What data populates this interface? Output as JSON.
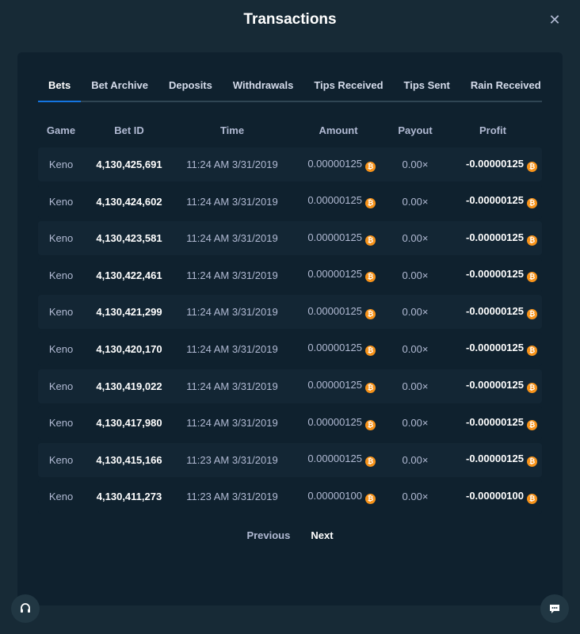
{
  "modal": {
    "title": "Transactions",
    "close_icon": "close-icon"
  },
  "tabs": [
    {
      "label": "Bets",
      "active": true
    },
    {
      "label": "Bet Archive"
    },
    {
      "label": "Deposits"
    },
    {
      "label": "Withdrawals"
    },
    {
      "label": "Tips Received"
    },
    {
      "label": "Tips Sent"
    },
    {
      "label": "Rain Received"
    }
  ],
  "table": {
    "headers": [
      "Game",
      "Bet ID",
      "Time",
      "Amount",
      "Payout",
      "Profit"
    ],
    "rows": [
      {
        "game": "Keno",
        "bet_id": "4,130,425,691",
        "time": "11:24 AM 3/31/2019",
        "amount": "0.00000125",
        "payout": "0.00×",
        "profit": "-0.00000125"
      },
      {
        "game": "Keno",
        "bet_id": "4,130,424,602",
        "time": "11:24 AM 3/31/2019",
        "amount": "0.00000125",
        "payout": "0.00×",
        "profit": "-0.00000125"
      },
      {
        "game": "Keno",
        "bet_id": "4,130,423,581",
        "time": "11:24 AM 3/31/2019",
        "amount": "0.00000125",
        "payout": "0.00×",
        "profit": "-0.00000125"
      },
      {
        "game": "Keno",
        "bet_id": "4,130,422,461",
        "time": "11:24 AM 3/31/2019",
        "amount": "0.00000125",
        "payout": "0.00×",
        "profit": "-0.00000125"
      },
      {
        "game": "Keno",
        "bet_id": "4,130,421,299",
        "time": "11:24 AM 3/31/2019",
        "amount": "0.00000125",
        "payout": "0.00×",
        "profit": "-0.00000125"
      },
      {
        "game": "Keno",
        "bet_id": "4,130,420,170",
        "time": "11:24 AM 3/31/2019",
        "amount": "0.00000125",
        "payout": "0.00×",
        "profit": "-0.00000125"
      },
      {
        "game": "Keno",
        "bet_id": "4,130,419,022",
        "time": "11:24 AM 3/31/2019",
        "amount": "0.00000125",
        "payout": "0.00×",
        "profit": "-0.00000125"
      },
      {
        "game": "Keno",
        "bet_id": "4,130,417,980",
        "time": "11:24 AM 3/31/2019",
        "amount": "0.00000125",
        "payout": "0.00×",
        "profit": "-0.00000125"
      },
      {
        "game": "Keno",
        "bet_id": "4,130,415,166",
        "time": "11:23 AM 3/31/2019",
        "amount": "0.00000125",
        "payout": "0.00×",
        "profit": "-0.00000125"
      },
      {
        "game": "Keno",
        "bet_id": "4,130,411,273",
        "time": "11:23 AM 3/31/2019",
        "amount": "0.00000100",
        "payout": "0.00×",
        "profit": "-0.00000100"
      }
    ],
    "currency_icon": "bitcoin-icon",
    "currency_color": "#f7931a"
  },
  "pager": {
    "previous": "Previous",
    "next": "Next"
  },
  "floating": {
    "support_icon": "headset-icon",
    "chat_icon": "chat-icon"
  },
  "colors": {
    "background": "#172a36",
    "panel": "#0f212e",
    "accent": "#1475e1",
    "text_muted": "#b1bad3",
    "text_strong": "#ffffff"
  }
}
